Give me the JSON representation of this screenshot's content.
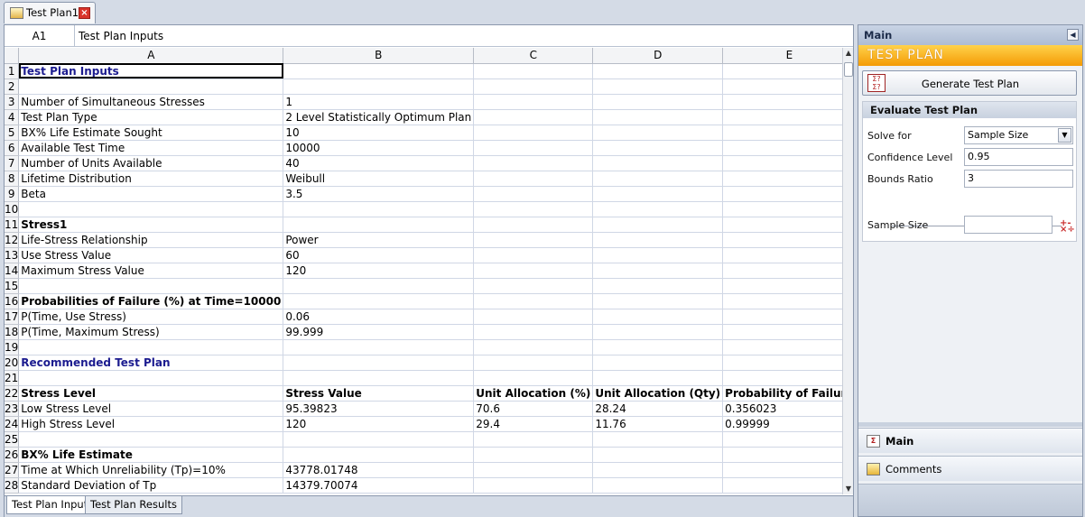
{
  "document_tab": {
    "label": "Test Plan1",
    "icon": "test-plan-icon",
    "close_icon": "close-icon"
  },
  "formula_bar": {
    "cell_ref": "A1",
    "content": "Test Plan Inputs"
  },
  "columns": [
    "A",
    "B",
    "C",
    "D",
    "E"
  ],
  "rows": [
    {
      "n": "1",
      "a": "Test Plan Inputs",
      "b": "",
      "c": "",
      "d": "",
      "e": "",
      "style": "blue"
    },
    {
      "n": "2",
      "a": "",
      "b": "",
      "c": "",
      "d": "",
      "e": "",
      "style": ""
    },
    {
      "n": "3",
      "a": "Number of Simultaneous Stresses",
      "b": "1",
      "c": "",
      "d": "",
      "e": "",
      "style": ""
    },
    {
      "n": "4",
      "a": "Test Plan Type",
      "b": "2 Level Statistically Optimum Plan",
      "c": "",
      "d": "",
      "e": "",
      "style": ""
    },
    {
      "n": "5",
      "a": "BX% Life Estimate Sought",
      "b": "10",
      "c": "",
      "d": "",
      "e": "",
      "style": ""
    },
    {
      "n": "6",
      "a": "Available Test Time",
      "b": "10000",
      "c": "",
      "d": "",
      "e": "",
      "style": ""
    },
    {
      "n": "7",
      "a": "Number of Units Available",
      "b": "40",
      "c": "",
      "d": "",
      "e": "",
      "style": ""
    },
    {
      "n": "8",
      "a": "Lifetime Distribution",
      "b": "Weibull",
      "c": "",
      "d": "",
      "e": "",
      "style": ""
    },
    {
      "n": "9",
      "a": "Beta",
      "b": "3.5",
      "c": "",
      "d": "",
      "e": "",
      "style": ""
    },
    {
      "n": "10",
      "a": "",
      "b": "",
      "c": "",
      "d": "",
      "e": "",
      "style": ""
    },
    {
      "n": "11",
      "a": "Stress1",
      "b": "",
      "c": "",
      "d": "",
      "e": "",
      "style": "bold"
    },
    {
      "n": "12",
      "a": "Life-Stress Relationship",
      "b": "Power",
      "c": "",
      "d": "",
      "e": "",
      "style": ""
    },
    {
      "n": "13",
      "a": "Use Stress Value",
      "b": "60",
      "c": "",
      "d": "",
      "e": "",
      "style": ""
    },
    {
      "n": "14",
      "a": "Maximum Stress Value",
      "b": "120",
      "c": "",
      "d": "",
      "e": "",
      "style": ""
    },
    {
      "n": "15",
      "a": "",
      "b": "",
      "c": "",
      "d": "",
      "e": "",
      "style": ""
    },
    {
      "n": "16",
      "a": "Probabilities of Failure (%) at Time=10000",
      "b": "",
      "c": "",
      "d": "",
      "e": "",
      "style": "bold"
    },
    {
      "n": "17",
      "a": "P(Time, Use Stress)",
      "b": "0.06",
      "c": "",
      "d": "",
      "e": "",
      "style": ""
    },
    {
      "n": "18",
      "a": "P(Time, Maximum Stress)",
      "b": "99.999",
      "c": "",
      "d": "",
      "e": "",
      "style": ""
    },
    {
      "n": "19",
      "a": "",
      "b": "",
      "c": "",
      "d": "",
      "e": "",
      "style": ""
    },
    {
      "n": "20",
      "a": "Recommended Test Plan",
      "b": "",
      "c": "",
      "d": "",
      "e": "",
      "style": "blue"
    },
    {
      "n": "21",
      "a": "",
      "b": "",
      "c": "",
      "d": "",
      "e": "",
      "style": ""
    },
    {
      "n": "22",
      "a": "Stress Level",
      "b": "Stress Value",
      "c": "Unit Allocation (%)",
      "d": "Unit Allocation (Qty)",
      "e": "Probability of Failure",
      "style": "bold"
    },
    {
      "n": "23",
      "a": "Low Stress Level",
      "b": "95.39823",
      "c": "70.6",
      "d": "28.24",
      "e": "0.356023",
      "style": ""
    },
    {
      "n": "24",
      "a": "High Stress Level",
      "b": "120",
      "c": "29.4",
      "d": "11.76",
      "e": "0.99999",
      "style": ""
    },
    {
      "n": "25",
      "a": "",
      "b": "",
      "c": "",
      "d": "",
      "e": "",
      "style": ""
    },
    {
      "n": "26",
      "a": "BX% Life Estimate",
      "b": "",
      "c": "",
      "d": "",
      "e": "",
      "style": "bold"
    },
    {
      "n": "27",
      "a": "Time at Which Unreliability (Tp)=10%",
      "b": "43778.01748",
      "c": "",
      "d": "",
      "e": "",
      "style": ""
    },
    {
      "n": "28",
      "a": "Standard Deviation of Tp",
      "b": "14379.70074",
      "c": "",
      "d": "",
      "e": "",
      "style": ""
    }
  ],
  "sheet_tabs": [
    "Test Plan Inputs",
    "Test Plan Results"
  ],
  "side_panel": {
    "header": "Main",
    "banner": "TEST PLAN",
    "generate_button": "Generate Test Plan",
    "eval_title": "Evaluate Test Plan",
    "solve_for_label": "Solve for",
    "solve_for_value": "Sample Size",
    "confidence_label": "Confidence Level",
    "confidence_value": "0.95",
    "bounds_label": "Bounds Ratio",
    "bounds_value": "3",
    "sample_size_label": "Sample Size",
    "sample_size_value": "",
    "nav_main": "Main",
    "nav_comments": "Comments"
  },
  "colors": {
    "accent_orange": "#f49b06",
    "header_blue": "#1b1b8f"
  }
}
